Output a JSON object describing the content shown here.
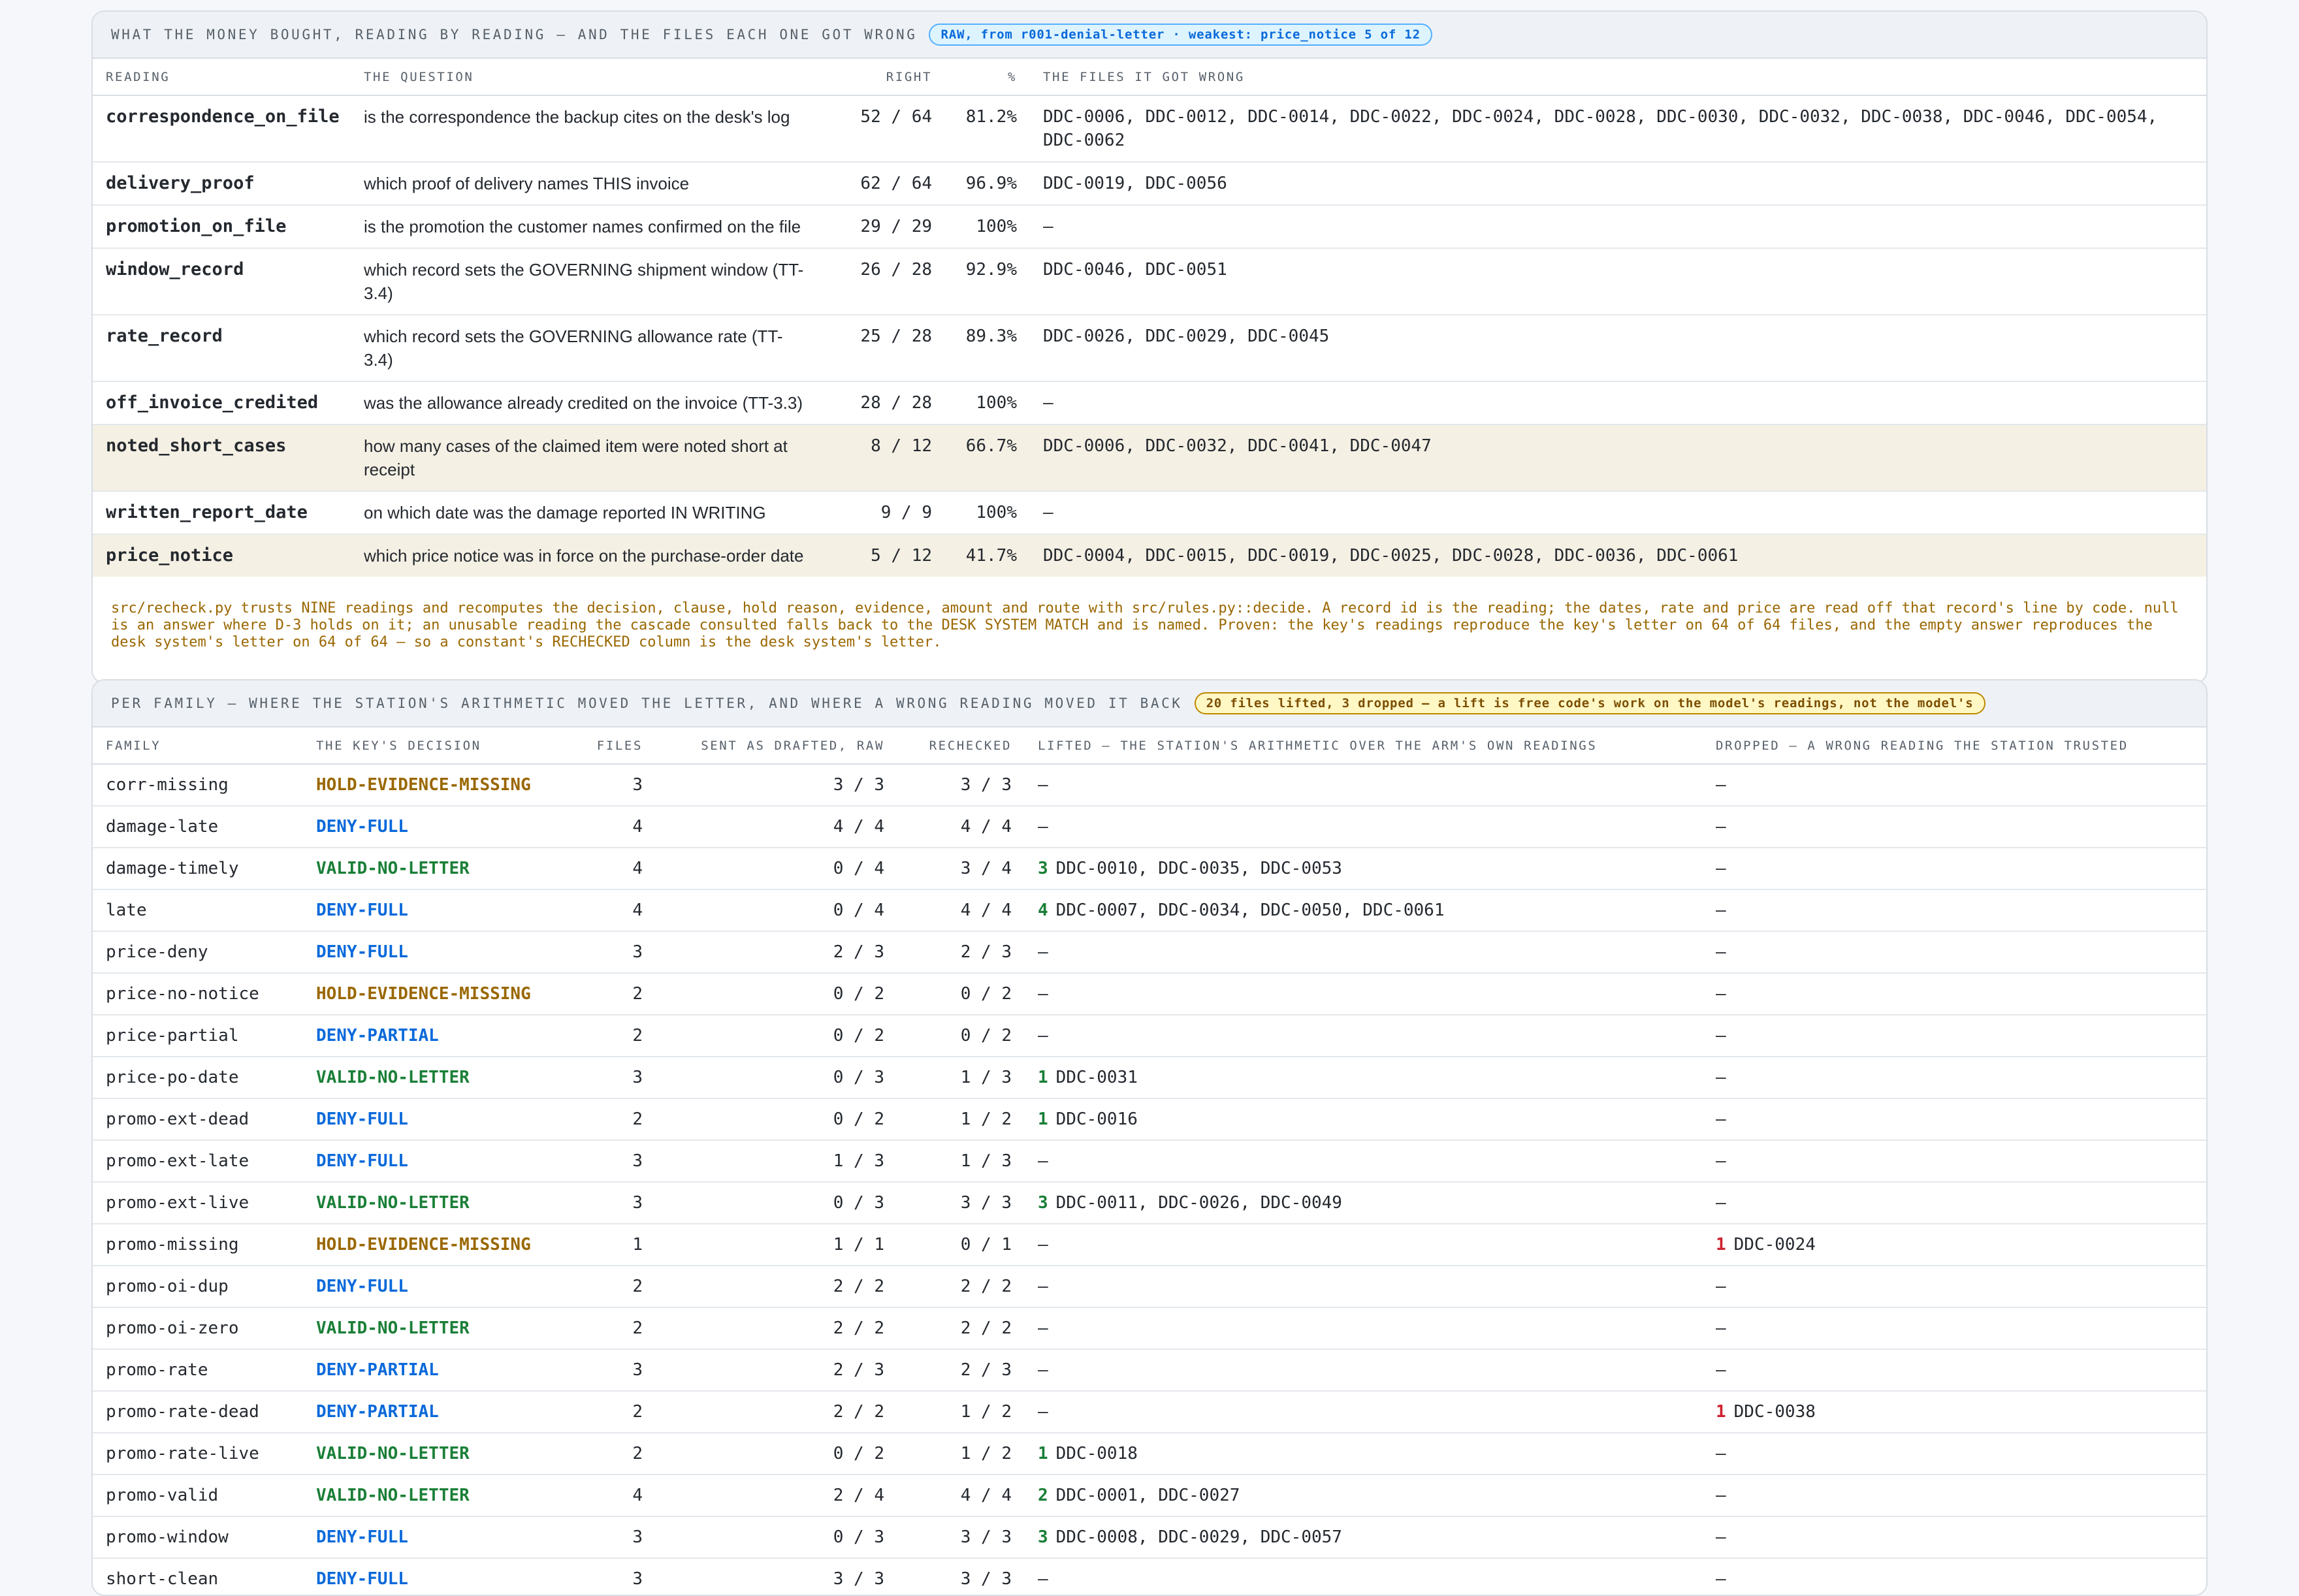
{
  "readings_panel": {
    "title": "WHAT THE MONEY BOUGHT, READING BY READING — AND THE FILES EACH ONE GOT WRONG",
    "badge": "RAW, from r001-denial-letter · weakest: price_notice 5 of 12",
    "columns": [
      "READING",
      "THE QUESTION",
      "RIGHT",
      "%",
      "THE FILES IT GOT WRONG"
    ],
    "rows": [
      {
        "reading": "correspondence_on_file",
        "question": "is the correspondence the backup cites on the desk's log",
        "right": "52 / 64",
        "pct": "81.2%",
        "wrong": "DDC-0006, DDC-0012, DDC-0014, DDC-0022, DDC-0024, DDC-0028, DDC-0030, DDC-0032, DDC-0038, DDC-0046, DDC-0054, DDC-0062",
        "highlight": false
      },
      {
        "reading": "delivery_proof",
        "question": "which proof of delivery names THIS invoice",
        "right": "62 / 64",
        "pct": "96.9%",
        "wrong": "DDC-0019, DDC-0056",
        "highlight": false
      },
      {
        "reading": "promotion_on_file",
        "question": "is the promotion the customer names confirmed on the file",
        "right": "29 / 29",
        "pct": "100%",
        "wrong": "—",
        "highlight": false
      },
      {
        "reading": "window_record",
        "question": "which record sets the GOVERNING shipment window (TT-3.4)",
        "right": "26 / 28",
        "pct": "92.9%",
        "wrong": "DDC-0046, DDC-0051",
        "highlight": false
      },
      {
        "reading": "rate_record",
        "question": "which record sets the GOVERNING allowance rate (TT-3.4)",
        "right": "25 / 28",
        "pct": "89.3%",
        "wrong": "DDC-0026, DDC-0029, DDC-0045",
        "highlight": false
      },
      {
        "reading": "off_invoice_credited",
        "question": "was the allowance already credited on the invoice (TT-3.3)",
        "right": "28 / 28",
        "pct": "100%",
        "wrong": "—",
        "highlight": false
      },
      {
        "reading": "noted_short_cases",
        "question": "how many cases of the claimed item were noted short at receipt",
        "right": "8 / 12",
        "pct": "66.7%",
        "wrong": "DDC-0006, DDC-0032, DDC-0041, DDC-0047",
        "highlight": true
      },
      {
        "reading": "written_report_date",
        "question": "on which date was the damage reported IN WRITING",
        "right": "9 / 9",
        "pct": "100%",
        "wrong": "—",
        "highlight": false
      },
      {
        "reading": "price_notice",
        "question": "which price notice was in force on the purchase-order date",
        "right": "5 / 12",
        "pct": "41.7%",
        "wrong": "DDC-0004, DDC-0015, DDC-0019, DDC-0025, DDC-0028, DDC-0036, DDC-0061",
        "highlight": true
      }
    ],
    "note": "src/recheck.py trusts NINE readings and recomputes the decision, clause, hold reason, evidence, amount and route with src/rules.py::decide. A record id is the reading; the dates, rate and price are read off that record's line by code. null is an answer where D-3 holds on it; an unusable reading the cascade consulted falls back to the DESK SYSTEM MATCH and is named. Proven: the key's readings reproduce the key's letter on 64 of 64 files, and the empty answer reproduces the desk system's letter on 64 of 64 — so a constant's RECHECKED column is the desk system's letter."
  },
  "family_panel": {
    "title": "PER FAMILY — WHERE THE STATION'S ARITHMETIC MOVED THE LETTER, AND WHERE A WRONG READING MOVED IT BACK",
    "badge": "20 files lifted, 3 dropped — a lift is free code's work on the model's readings, not the model's",
    "columns": [
      "FAMILY",
      "THE KEY'S DECISION",
      "FILES",
      "SENT AS DRAFTED, RAW",
      "RECHECKED",
      "LIFTED — THE STATION'S ARITHMETIC OVER THE ARM'S OWN READINGS",
      "DROPPED — A WRONG READING THE STATION TRUSTED"
    ],
    "rows": [
      {
        "family": "corr-missing",
        "decision": "HOLD-EVIDENCE-MISSING",
        "kind": "hold",
        "files": "3",
        "raw": "3 / 3",
        "rechecked": "3 / 3",
        "lifted_n": "",
        "lifted": "—",
        "dropped_n": "",
        "dropped": "—"
      },
      {
        "family": "damage-late",
        "decision": "DENY-FULL",
        "kind": "deny",
        "files": "4",
        "raw": "4 / 4",
        "rechecked": "4 / 4",
        "lifted_n": "",
        "lifted": "—",
        "dropped_n": "",
        "dropped": "—"
      },
      {
        "family": "damage-timely",
        "decision": "VALID-NO-LETTER",
        "kind": "valid",
        "files": "4",
        "raw": "0 / 4",
        "rechecked": "3 / 4",
        "lifted_n": "3",
        "lifted": "DDC-0010, DDC-0035, DDC-0053",
        "dropped_n": "",
        "dropped": "—"
      },
      {
        "family": "late",
        "decision": "DENY-FULL",
        "kind": "deny",
        "files": "4",
        "raw": "0 / 4",
        "rechecked": "4 / 4",
        "lifted_n": "4",
        "lifted": "DDC-0007, DDC-0034, DDC-0050, DDC-0061",
        "dropped_n": "",
        "dropped": "—"
      },
      {
        "family": "price-deny",
        "decision": "DENY-FULL",
        "kind": "deny",
        "files": "3",
        "raw": "2 / 3",
        "rechecked": "2 / 3",
        "lifted_n": "",
        "lifted": "—",
        "dropped_n": "",
        "dropped": "—"
      },
      {
        "family": "price-no-notice",
        "decision": "HOLD-EVIDENCE-MISSING",
        "kind": "hold",
        "files": "2",
        "raw": "0 / 2",
        "rechecked": "0 / 2",
        "lifted_n": "",
        "lifted": "—",
        "dropped_n": "",
        "dropped": "—"
      },
      {
        "family": "price-partial",
        "decision": "DENY-PARTIAL",
        "kind": "deny",
        "files": "2",
        "raw": "0 / 2",
        "rechecked": "0 / 2",
        "lifted_n": "",
        "lifted": "—",
        "dropped_n": "",
        "dropped": "—"
      },
      {
        "family": "price-po-date",
        "decision": "VALID-NO-LETTER",
        "kind": "valid",
        "files": "3",
        "raw": "0 / 3",
        "rechecked": "1 / 3",
        "lifted_n": "1",
        "lifted": "DDC-0031",
        "dropped_n": "",
        "dropped": "—"
      },
      {
        "family": "promo-ext-dead",
        "decision": "DENY-FULL",
        "kind": "deny",
        "files": "2",
        "raw": "0 / 2",
        "rechecked": "1 / 2",
        "lifted_n": "1",
        "lifted": "DDC-0016",
        "dropped_n": "",
        "dropped": "—"
      },
      {
        "family": "promo-ext-late",
        "decision": "DENY-FULL",
        "kind": "deny",
        "files": "3",
        "raw": "1 / 3",
        "rechecked": "1 / 3",
        "lifted_n": "",
        "lifted": "—",
        "dropped_n": "",
        "dropped": "—"
      },
      {
        "family": "promo-ext-live",
        "decision": "VALID-NO-LETTER",
        "kind": "valid",
        "files": "3",
        "raw": "0 / 3",
        "rechecked": "3 / 3",
        "lifted_n": "3",
        "lifted": "DDC-0011, DDC-0026, DDC-0049",
        "dropped_n": "",
        "dropped": "—"
      },
      {
        "family": "promo-missing",
        "decision": "HOLD-EVIDENCE-MISSING",
        "kind": "hold",
        "files": "1",
        "raw": "1 / 1",
        "rechecked": "0 / 1",
        "lifted_n": "",
        "lifted": "—",
        "dropped_n": "1",
        "dropped": "DDC-0024"
      },
      {
        "family": "promo-oi-dup",
        "decision": "DENY-FULL",
        "kind": "deny",
        "files": "2",
        "raw": "2 / 2",
        "rechecked": "2 / 2",
        "lifted_n": "",
        "lifted": "—",
        "dropped_n": "",
        "dropped": "—"
      },
      {
        "family": "promo-oi-zero",
        "decision": "VALID-NO-LETTER",
        "kind": "valid",
        "files": "2",
        "raw": "2 / 2",
        "rechecked": "2 / 2",
        "lifted_n": "",
        "lifted": "—",
        "dropped_n": "",
        "dropped": "—"
      },
      {
        "family": "promo-rate",
        "decision": "DENY-PARTIAL",
        "kind": "deny",
        "files": "3",
        "raw": "2 / 3",
        "rechecked": "2 / 3",
        "lifted_n": "",
        "lifted": "—",
        "dropped_n": "",
        "dropped": "—"
      },
      {
        "family": "promo-rate-dead",
        "decision": "DENY-PARTIAL",
        "kind": "deny",
        "files": "2",
        "raw": "2 / 2",
        "rechecked": "1 / 2",
        "lifted_n": "",
        "lifted": "—",
        "dropped_n": "1",
        "dropped": "DDC-0038"
      },
      {
        "family": "promo-rate-live",
        "decision": "VALID-NO-LETTER",
        "kind": "valid",
        "files": "2",
        "raw": "0 / 2",
        "rechecked": "1 / 2",
        "lifted_n": "1",
        "lifted": "DDC-0018",
        "dropped_n": "",
        "dropped": "—"
      },
      {
        "family": "promo-valid",
        "decision": "VALID-NO-LETTER",
        "kind": "valid",
        "files": "4",
        "raw": "2 / 4",
        "rechecked": "4 / 4",
        "lifted_n": "2",
        "lifted": "DDC-0001, DDC-0027",
        "dropped_n": "",
        "dropped": "—"
      },
      {
        "family": "promo-window",
        "decision": "DENY-FULL",
        "kind": "deny",
        "files": "3",
        "raw": "0 / 3",
        "rechecked": "3 / 3",
        "lifted_n": "3",
        "lifted": "DDC-0008, DDC-0029, DDC-0057",
        "dropped_n": "",
        "dropped": "—"
      },
      {
        "family": "short-clean",
        "decision": "DENY-FULL",
        "kind": "deny",
        "files": "3",
        "raw": "3 / 3",
        "rechecked": "3 / 3",
        "lifted_n": "",
        "lifted": "—",
        "dropped_n": "",
        "dropped": "—"
      }
    ]
  }
}
